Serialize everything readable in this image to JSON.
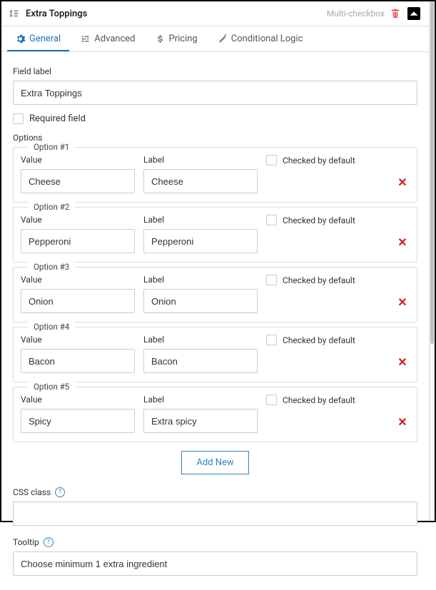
{
  "header": {
    "title": "Extra Toppings",
    "field_type": "Multi-checkbox"
  },
  "tabs": {
    "general": "General",
    "advanced": "Advanced",
    "pricing": "Pricing",
    "conditional": "Conditional Logic"
  },
  "labels": {
    "field_label": "Field label",
    "required_field": "Required field",
    "options": "Options",
    "value": "Value",
    "label": "Label",
    "checked_default": "Checked by default",
    "add_new": "Add New",
    "css_class": "CSS class",
    "tooltip": "Tooltip"
  },
  "field_label_value": "Extra Toppings",
  "css_class_value": "",
  "tooltip_value": "Choose minimum 1 extra ingredient",
  "options": [
    {
      "legend": "Option #1",
      "value": "Cheese",
      "label": "Cheese"
    },
    {
      "legend": "Option #2",
      "value": "Pepperoni",
      "label": "Pepperoni"
    },
    {
      "legend": "Option #3",
      "value": "Onion",
      "label": "Onion"
    },
    {
      "legend": "Option #4",
      "value": "Bacon",
      "label": "Bacon"
    },
    {
      "legend": "Option #5",
      "value": "Spicy",
      "label": "Extra spicy"
    }
  ]
}
